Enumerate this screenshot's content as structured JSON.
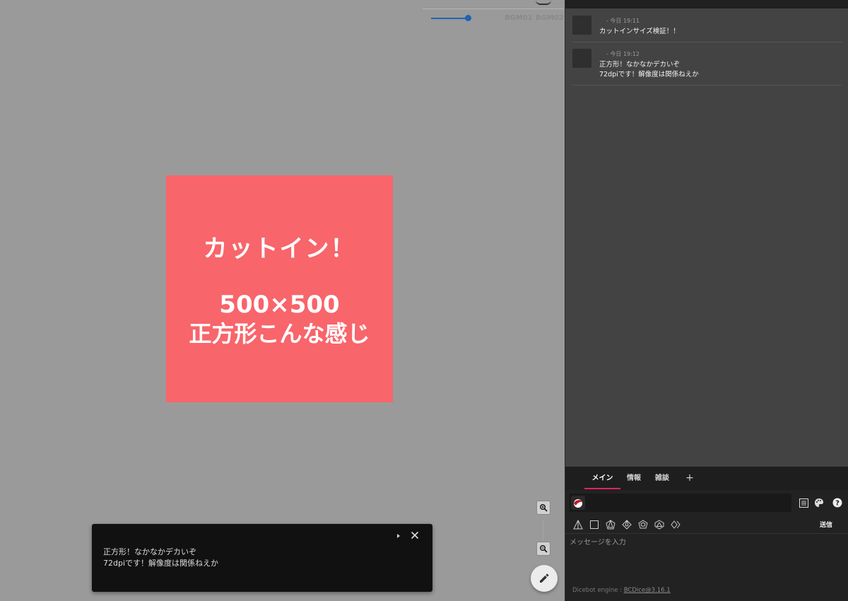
{
  "bgm": {
    "volume": 0.9,
    "tracks": [
      "BGM01",
      "BGM02"
    ]
  },
  "cutin": {
    "line1": "カットイン！",
    "line2": "500×500",
    "line3": "正方形こんな感じ",
    "color": "#f8656b"
  },
  "snackbar": {
    "line1": "正方形！なかなかデカいぞ",
    "line2": "72dpiです！解像度は関係ねえか"
  },
  "messages": [
    {
      "meta": "- 今日 19:11",
      "lines": [
        "カットインサイズ検証！！"
      ]
    },
    {
      "meta": "- 今日 19:12",
      "lines": [
        "正方形！なかなかデカいぞ",
        "72dpiです！解像度は関係ねえか"
      ]
    }
  ],
  "tabs": [
    "メイン",
    "情報",
    "雑談"
  ],
  "tab_add": "+",
  "input": {
    "placeholder": "メッセージを入力",
    "send_label": "送信"
  },
  "engine": {
    "label": "Dicebot engine : ",
    "link": "BCDice@3.16.1"
  },
  "colors": {
    "accent": "#e0245e",
    "volume": "#1e63b5"
  }
}
